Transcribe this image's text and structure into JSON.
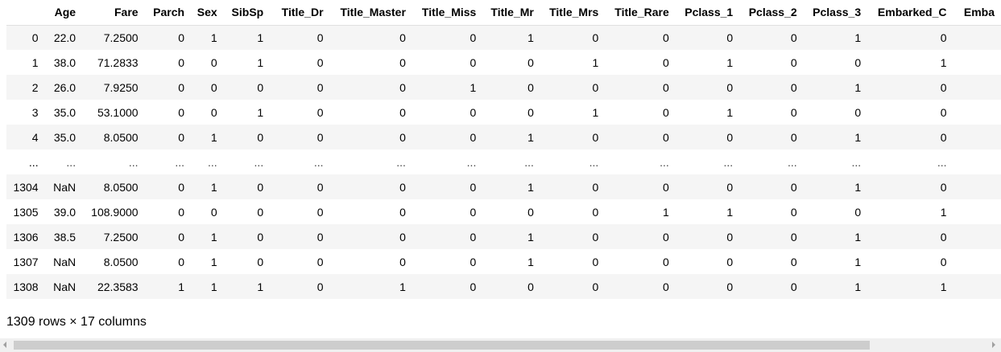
{
  "columns": [
    "",
    "Age",
    "Fare",
    "Parch",
    "Sex",
    "SibSp",
    "Title_Dr",
    "Title_Master",
    "Title_Miss",
    "Title_Mr",
    "Title_Mrs",
    "Title_Rare",
    "Pclass_1",
    "Pclass_2",
    "Pclass_3",
    "Embarked_C",
    "Emba"
  ],
  "rows": [
    [
      "0",
      "22.0",
      "7.2500",
      "0",
      "1",
      "1",
      "0",
      "0",
      "0",
      "1",
      "0",
      "0",
      "0",
      "0",
      "1",
      "0",
      ""
    ],
    [
      "1",
      "38.0",
      "71.2833",
      "0",
      "0",
      "1",
      "0",
      "0",
      "0",
      "0",
      "1",
      "0",
      "1",
      "0",
      "0",
      "1",
      ""
    ],
    [
      "2",
      "26.0",
      "7.9250",
      "0",
      "0",
      "0",
      "0",
      "0",
      "1",
      "0",
      "0",
      "0",
      "0",
      "0",
      "1",
      "0",
      ""
    ],
    [
      "3",
      "35.0",
      "53.1000",
      "0",
      "0",
      "1",
      "0",
      "0",
      "0",
      "0",
      "1",
      "0",
      "1",
      "0",
      "0",
      "0",
      ""
    ],
    [
      "4",
      "35.0",
      "8.0500",
      "0",
      "1",
      "0",
      "0",
      "0",
      "0",
      "1",
      "0",
      "0",
      "0",
      "0",
      "1",
      "0",
      ""
    ],
    [
      "...",
      "...",
      "...",
      "...",
      "...",
      "...",
      "...",
      "...",
      "...",
      "...",
      "...",
      "...",
      "...",
      "...",
      "...",
      "...",
      ""
    ],
    [
      "1304",
      "NaN",
      "8.0500",
      "0",
      "1",
      "0",
      "0",
      "0",
      "0",
      "1",
      "0",
      "0",
      "0",
      "0",
      "1",
      "0",
      ""
    ],
    [
      "1305",
      "39.0",
      "108.9000",
      "0",
      "0",
      "0",
      "0",
      "0",
      "0",
      "0",
      "0",
      "1",
      "1",
      "0",
      "0",
      "1",
      ""
    ],
    [
      "1306",
      "38.5",
      "7.2500",
      "0",
      "1",
      "0",
      "0",
      "0",
      "0",
      "1",
      "0",
      "0",
      "0",
      "0",
      "1",
      "0",
      ""
    ],
    [
      "1307",
      "NaN",
      "8.0500",
      "0",
      "1",
      "0",
      "0",
      "0",
      "0",
      "1",
      "0",
      "0",
      "0",
      "0",
      "1",
      "0",
      ""
    ],
    [
      "1308",
      "NaN",
      "22.3583",
      "1",
      "1",
      "1",
      "0",
      "1",
      "0",
      "0",
      "0",
      "0",
      "0",
      "0",
      "1",
      "1",
      ""
    ]
  ],
  "footer": {
    "shape_text": "1309 rows × 17 columns"
  }
}
